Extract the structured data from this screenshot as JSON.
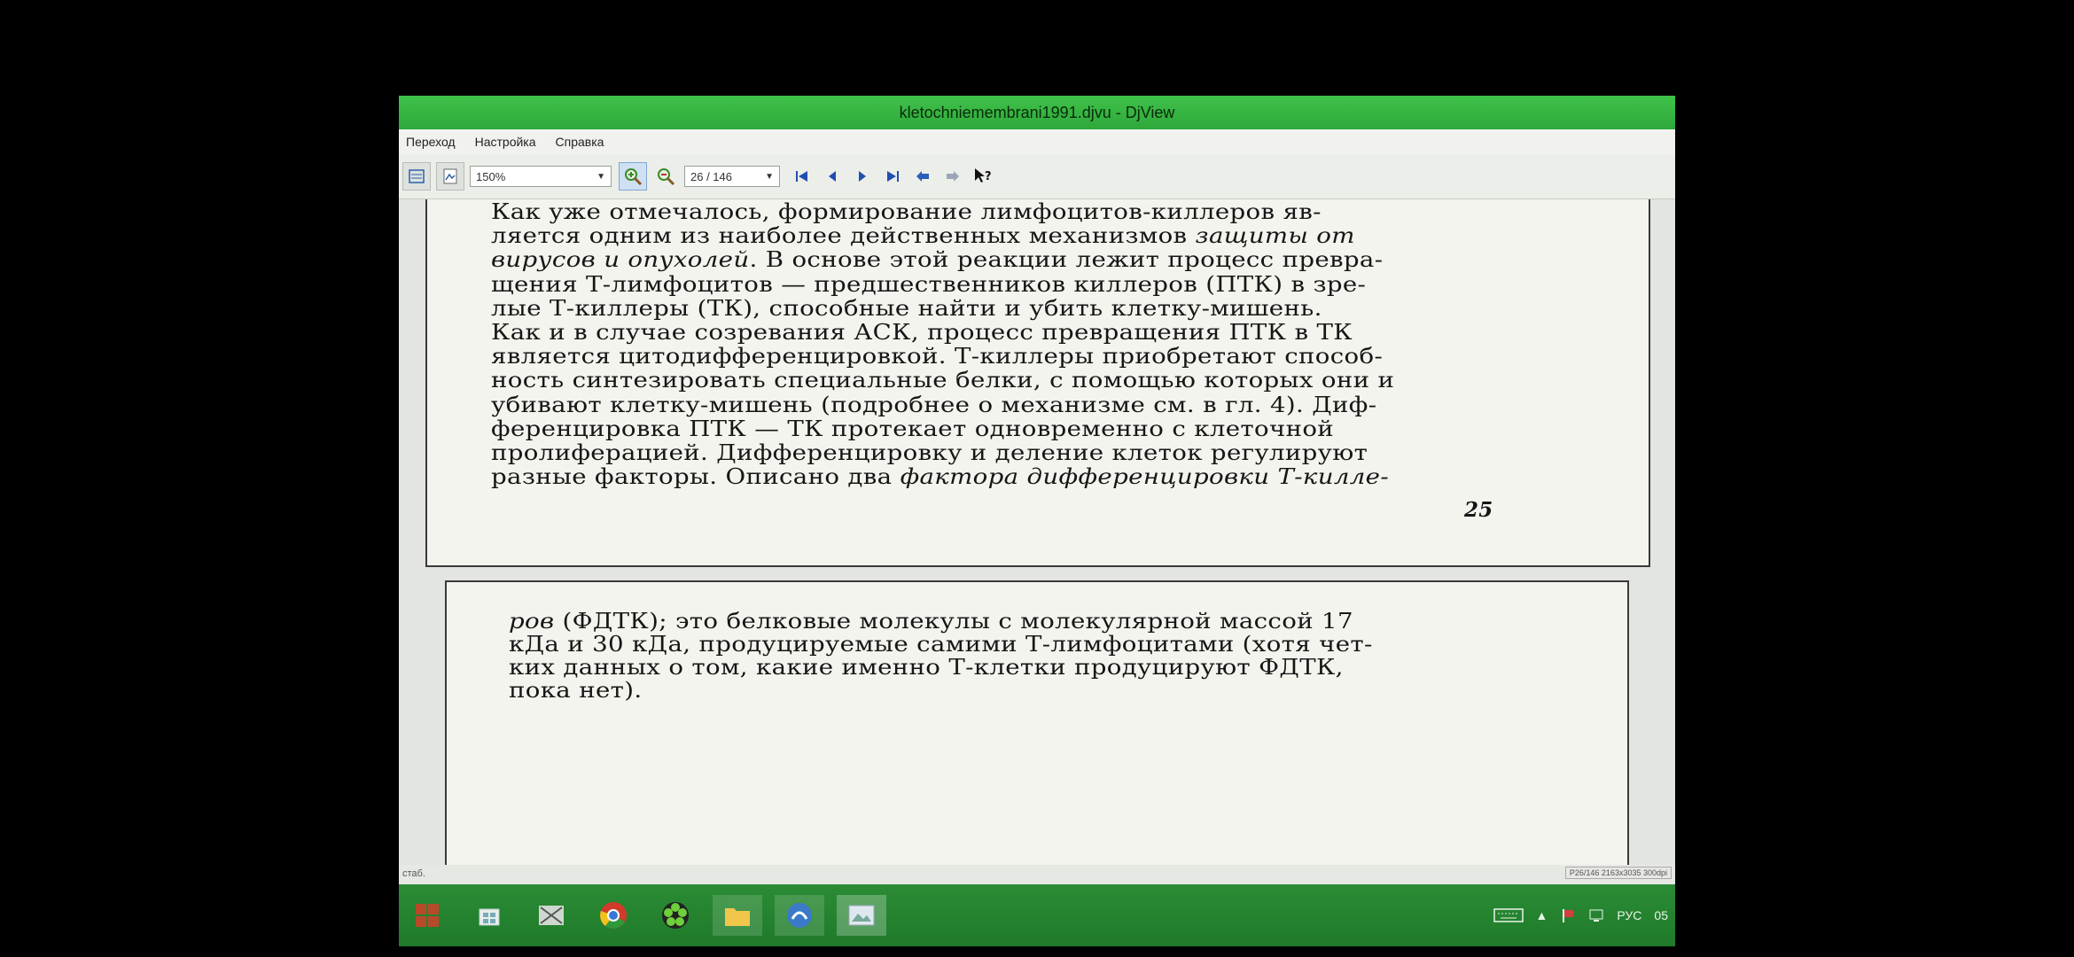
{
  "window": {
    "title": "kletochniemembrani1991.djvu - DjView"
  },
  "menu": {
    "items": [
      "Переход",
      "Настройка",
      "Справка"
    ]
  },
  "toolbar": {
    "zoom_value": "150%",
    "page_value": "26 / 146"
  },
  "document": {
    "page1_lines": [
      {
        "segments": [
          {
            "t": "Как уже отмечалось, формирование лимфоцитов-киллеров яв-",
            "i": false
          }
        ]
      },
      {
        "segments": [
          {
            "t": "ляется одним из наиболее действенных механизмов ",
            "i": false
          },
          {
            "t": "защиты от",
            "i": true
          }
        ]
      },
      {
        "segments": [
          {
            "t": "вирусов и опухолей",
            "i": true
          },
          {
            "t": ". В основе этой реакции лежит процесс превра-",
            "i": false
          }
        ]
      },
      {
        "segments": [
          {
            "t": "щения Т-лимфоцитов — предшественников киллеров (ПТК) в зре-",
            "i": false
          }
        ]
      },
      {
        "segments": [
          {
            "t": "лые Т-киллеры (ТК), способные найти и убить клетку-мишень.",
            "i": false
          }
        ]
      },
      {
        "segments": [
          {
            "t": "Как и в случае созревания АСК, процесс превращения ПТК в ТК",
            "i": false
          }
        ]
      },
      {
        "segments": [
          {
            "t": "является цитодифференцировкой. Т-киллеры приобретают способ-",
            "i": false
          }
        ]
      },
      {
        "segments": [
          {
            "t": "ность синтезировать специальные белки, с помощью которых они и",
            "i": false
          }
        ]
      },
      {
        "segments": [
          {
            "t": "убивают клетку-мишень (подробнее о механизме см. в гл. 4). Диф-",
            "i": false
          }
        ]
      },
      {
        "segments": [
          {
            "t": "ференцировка ПТК — ТК протекает одновременно с клеточной",
            "i": false
          }
        ]
      },
      {
        "segments": [
          {
            "t": "пролиферацией. Дифференцировку и деление клеток регулируют",
            "i": false
          }
        ]
      },
      {
        "segments": [
          {
            "t": "разные факторы. Описано два ",
            "i": false
          },
          {
            "t": "фактора дифференцировки Т-килле-",
            "i": true
          }
        ]
      }
    ],
    "page1_number": "25",
    "page2_lines": [
      {
        "segments": [
          {
            "t": "ров",
            "i": true
          },
          {
            "t": " (ФДТК); это белковые молекулы с молекулярной массой 17",
            "i": false
          }
        ]
      },
      {
        "segments": [
          {
            "t": "кДа и 30 кДа, продуцируемые самими Т-лимфоцитами (хотя чет-",
            "i": false
          }
        ]
      },
      {
        "segments": [
          {
            "t": "ких данных о том, какие именно Т-клетки продуцируют ФДТК,",
            "i": false
          }
        ]
      },
      {
        "segments": [
          {
            "t": "пока нет).",
            "i": false
          }
        ]
      }
    ]
  },
  "status": {
    "left_text": "стаб.",
    "right_text": "P26/146 2163x3035 300dpi"
  },
  "taskbar": {
    "lang": "РУС",
    "clock": "05"
  }
}
